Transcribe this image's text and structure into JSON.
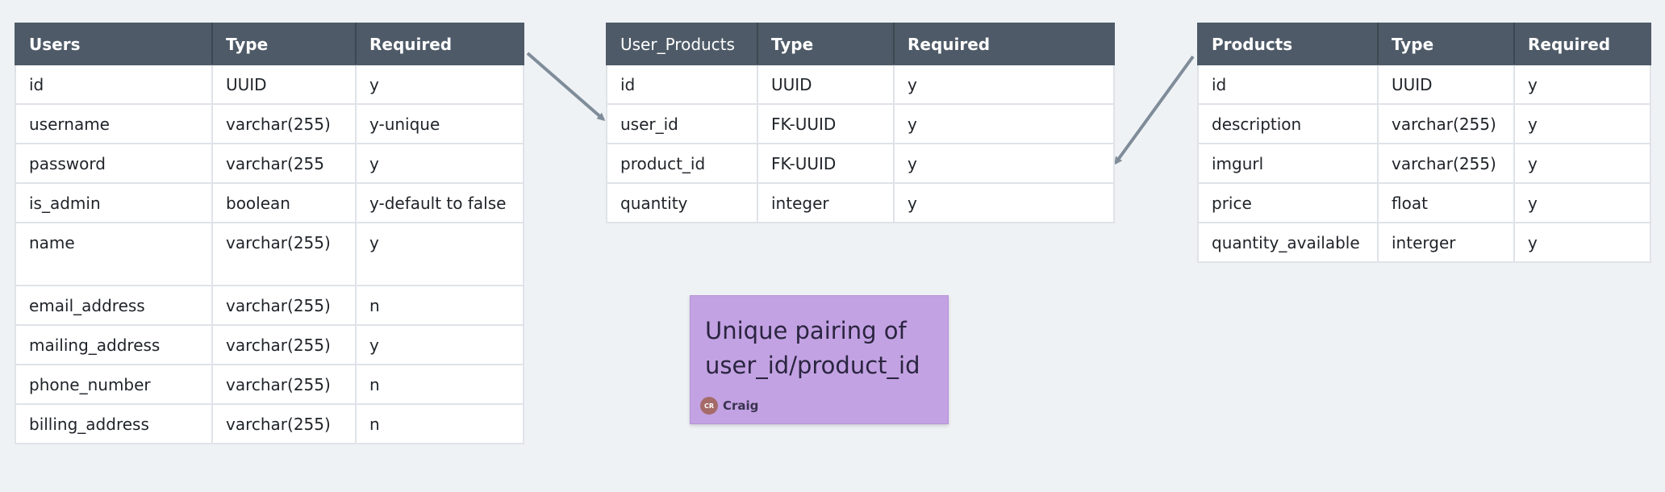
{
  "colors": {
    "canvas": "#eff2f5",
    "header": "#4e5a67",
    "sticky": "#c3a2e3",
    "arrow": "#7f8c99",
    "avatar": "#a46b68"
  },
  "tables": {
    "users": {
      "headers": [
        "Users",
        "Type",
        "Required"
      ],
      "rows": [
        [
          "id",
          "UUID",
          "y"
        ],
        [
          "username",
          "varchar(255)",
          "y-unique"
        ],
        [
          "password",
          "varchar(255",
          "y"
        ],
        [
          "is_admin",
          "boolean",
          "y-default to false"
        ],
        [
          "name",
          "varchar(255)",
          "y"
        ],
        [
          "email_address",
          "varchar(255)",
          "n"
        ],
        [
          "mailing_address",
          "varchar(255)",
          "y"
        ],
        [
          "phone_number",
          "varchar(255)",
          "n"
        ],
        [
          "billing_address",
          "varchar(255)",
          "n"
        ]
      ]
    },
    "user_products": {
      "headers": [
        "User_Products",
        "Type",
        "Required"
      ],
      "rows": [
        [
          "id",
          "UUID",
          "y"
        ],
        [
          "user_id",
          "FK-UUID",
          "y"
        ],
        [
          "product_id",
          "FK-UUID",
          "y"
        ],
        [
          "quantity",
          "integer",
          "y"
        ]
      ]
    },
    "products": {
      "headers": [
        "Products",
        "Type",
        "Required"
      ],
      "rows": [
        [
          "id",
          "UUID",
          "y"
        ],
        [
          "description",
          "varchar(255)",
          "y"
        ],
        [
          "imgurl",
          "varchar(255)",
          "y"
        ],
        [
          "price",
          "float",
          "y"
        ],
        [
          "quantity_available",
          "interger",
          "y"
        ]
      ]
    }
  },
  "sticky_note": {
    "text": "Unique pairing of\nuser_id/product_id",
    "author_initials": "CR",
    "author_name": "Craig"
  }
}
